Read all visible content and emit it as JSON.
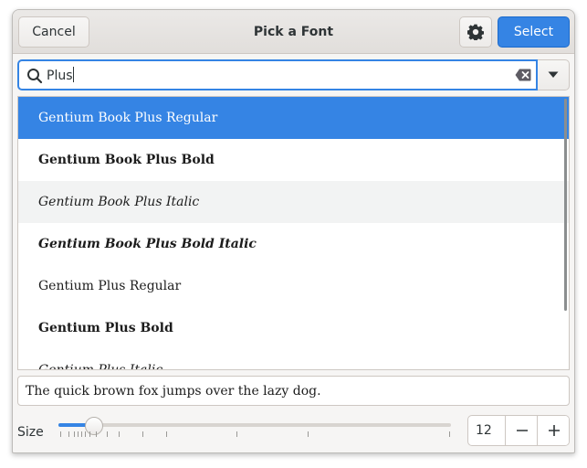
{
  "dialog": {
    "title": "Pick a Font",
    "cancel_label": "Cancel",
    "select_label": "Select",
    "accent_color": "#3584e4"
  },
  "search": {
    "value": "Plus"
  },
  "font_list": {
    "items": [
      {
        "label": "Gentium Book Plus Regular",
        "state": "selected"
      },
      {
        "label": "Gentium Book Plus Bold",
        "state": "normal"
      },
      {
        "label": "Gentium Book Plus Italic",
        "state": "hover"
      },
      {
        "label": "Gentium Book Plus Bold Italic",
        "state": "normal"
      },
      {
        "label": "Gentium Plus Regular",
        "state": "normal"
      },
      {
        "label": "Gentium Plus Bold",
        "state": "normal"
      },
      {
        "label": "Gentium Plus Italic",
        "state": "normal"
      }
    ]
  },
  "preview": {
    "text": "The quick brown fox jumps over the lazy dog."
  },
  "size": {
    "label": "Size",
    "value": "12",
    "slider_level": 0.09
  },
  "icons": {
    "search": "search-icon",
    "clear": "clear-text-icon",
    "dropdown": "pan-down-icon",
    "settings": "gear-icon",
    "minus": "minus-icon",
    "plus": "plus-icon"
  }
}
